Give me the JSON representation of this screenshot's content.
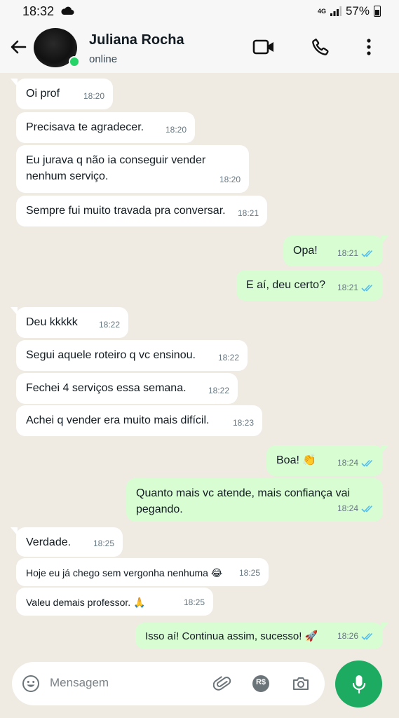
{
  "status_bar": {
    "time": "18:32",
    "network": "4G",
    "battery": "57%"
  },
  "header": {
    "contact_name": "Juliana Rocha",
    "status": "online"
  },
  "messages": [
    {
      "dir": "in",
      "text": "Oi prof",
      "time": "18:20"
    },
    {
      "dir": "in",
      "text": "Precisava te agradecer.",
      "time": "18:20"
    },
    {
      "dir": "in",
      "text": "Eu jurava q não ia conseguir vender nenhum serviço.",
      "time": "18:20"
    },
    {
      "dir": "in",
      "text": "Sempre fui muito travada pra conversar.",
      "time": "18:21"
    },
    {
      "dir": "out",
      "text": "Opa!",
      "time": "18:21",
      "read": true
    },
    {
      "dir": "out",
      "text": "E aí, deu certo?",
      "time": "18:21",
      "read": true
    },
    {
      "dir": "in",
      "text": "Deu kkkkk",
      "time": "18:22"
    },
    {
      "dir": "in",
      "text": "Segui aquele roteiro q vc ensinou.",
      "time": "18:22"
    },
    {
      "dir": "in",
      "text": "Fechei 4 serviços essa semana.",
      "time": "18:22"
    },
    {
      "dir": "in",
      "text": "Achei q vender era muito mais difícil.",
      "time": "18:23"
    },
    {
      "dir": "out",
      "text": "Boa! 👏",
      "time": "18:24",
      "read": true
    },
    {
      "dir": "out",
      "text": "Quanto mais vc atende, mais confiança vai pegando.",
      "time": "18:24",
      "read": true
    },
    {
      "dir": "in",
      "text": "Verdade.",
      "time": "18:25"
    },
    {
      "dir": "in",
      "text": "Hoje eu já chego sem vergonha nenhuma 😂",
      "time": "18:25"
    },
    {
      "dir": "in",
      "text": "Valeu demais professor. 🙏",
      "time": "18:25"
    },
    {
      "dir": "out",
      "text": "Isso aí! Continua assim, sucesso! 🚀",
      "time": "18:26",
      "read": true
    }
  ],
  "input": {
    "placeholder": "Mensagem",
    "pix_label": "R$"
  },
  "colors": {
    "accent": "#1daa61",
    "outgoing_bubble": "#d9fdd3",
    "read_ticks": "#53bdeb",
    "chat_bg": "#efeae2"
  },
  "icons": [
    "back-arrow-icon",
    "video-call-icon",
    "phone-icon",
    "more-vert-icon",
    "emoji-icon",
    "attach-icon",
    "pix-icon",
    "camera-icon",
    "mic-icon"
  ]
}
